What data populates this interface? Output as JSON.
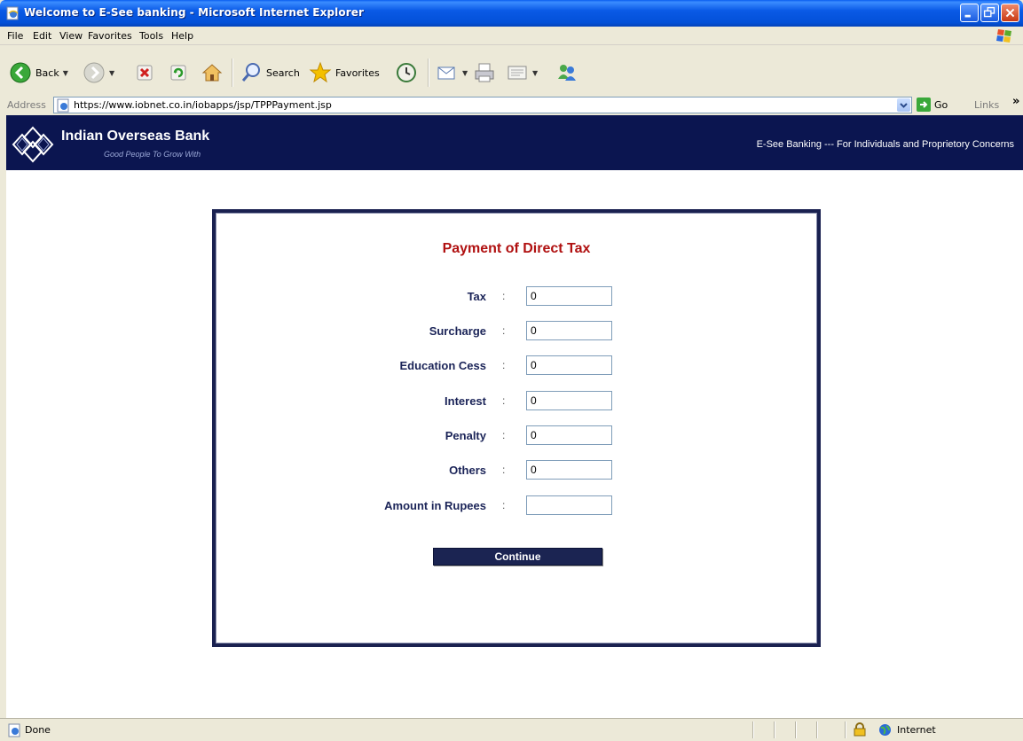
{
  "window": {
    "title": "Welcome to E-See banking - Microsoft Internet Explorer"
  },
  "menu": [
    "File",
    "Edit",
    "View",
    "Favorites",
    "Tools",
    "Help"
  ],
  "toolbar": {
    "back_label": "Back",
    "search_label": "Search",
    "favorites_label": "Favorites"
  },
  "address": {
    "label": "Address",
    "url": "https://www.iobnet.co.in/iobapps/jsp/TPPPayment.jsp",
    "go_label": "Go",
    "links_label": "Links"
  },
  "banner": {
    "bank_name": "Indian Overseas Bank",
    "tagline": "Good People To Grow With",
    "banking_text": "E-See Banking --- For Individuals and Proprietory Concerns",
    "color": "#0b1550"
  },
  "form": {
    "title": "Payment of Direct Tax",
    "separator": ":",
    "fields": [
      {
        "label": "Tax",
        "value": "0"
      },
      {
        "label": "Surcharge",
        "value": "0"
      },
      {
        "label": "Education Cess",
        "value": "0"
      },
      {
        "label": "Interest",
        "value": "0"
      },
      {
        "label": "Penalty",
        "value": "0"
      },
      {
        "label": "Others",
        "value": "0"
      },
      {
        "label": "Amount in Rupees",
        "value": ""
      }
    ],
    "continue_label": "Continue",
    "title_color": "#b01010",
    "label_color": "#1b2458"
  },
  "status": {
    "text": "Done",
    "zone": "Internet"
  }
}
